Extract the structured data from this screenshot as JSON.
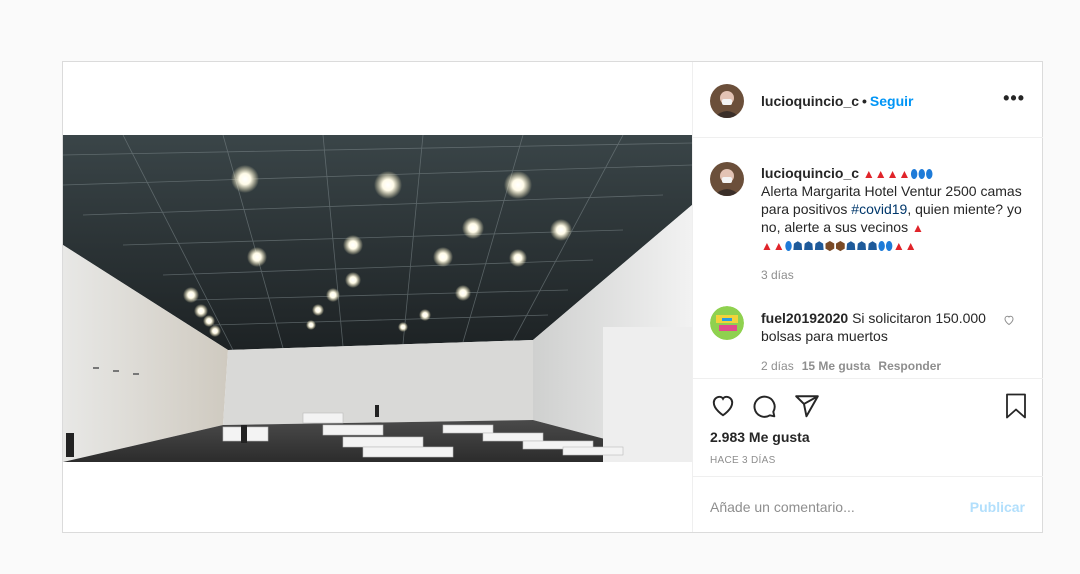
{
  "post": {
    "author": "lucioquincio_c",
    "follow_label": "Seguir",
    "dot": "•",
    "more_label": "•••"
  },
  "caption": {
    "author": "lucioquincio_c",
    "text_before": "Alerta Margarita Hotel Ventur 2500 camas para positivos",
    "hashtag": "#covid19",
    "text_after": ", quien miente? yo no, alerte a sus vecinos",
    "time": "3 días"
  },
  "comment": {
    "author": "fuel20192020",
    "text": "Si solicitaron 150.000 bolsas para muertos",
    "time": "2 días",
    "likes": "15 Me gusta",
    "reply": "Responder"
  },
  "stats": {
    "likes": "2.983 Me gusta",
    "ago": "HACE 3 DÍAS"
  },
  "compose": {
    "placeholder": "Añade un comentario...",
    "submit": "Publicar"
  },
  "colors": {
    "accent": "#0095f6",
    "submit_disabled": "#b2dffc",
    "muted": "#8e8e8e"
  },
  "icons": [
    "heart-icon",
    "comment-icon",
    "share-icon",
    "bookmark-icon",
    "more-icon",
    "siren-emoji",
    "pill-emoji",
    "zombie-emoji",
    "coffin-emoji"
  ]
}
